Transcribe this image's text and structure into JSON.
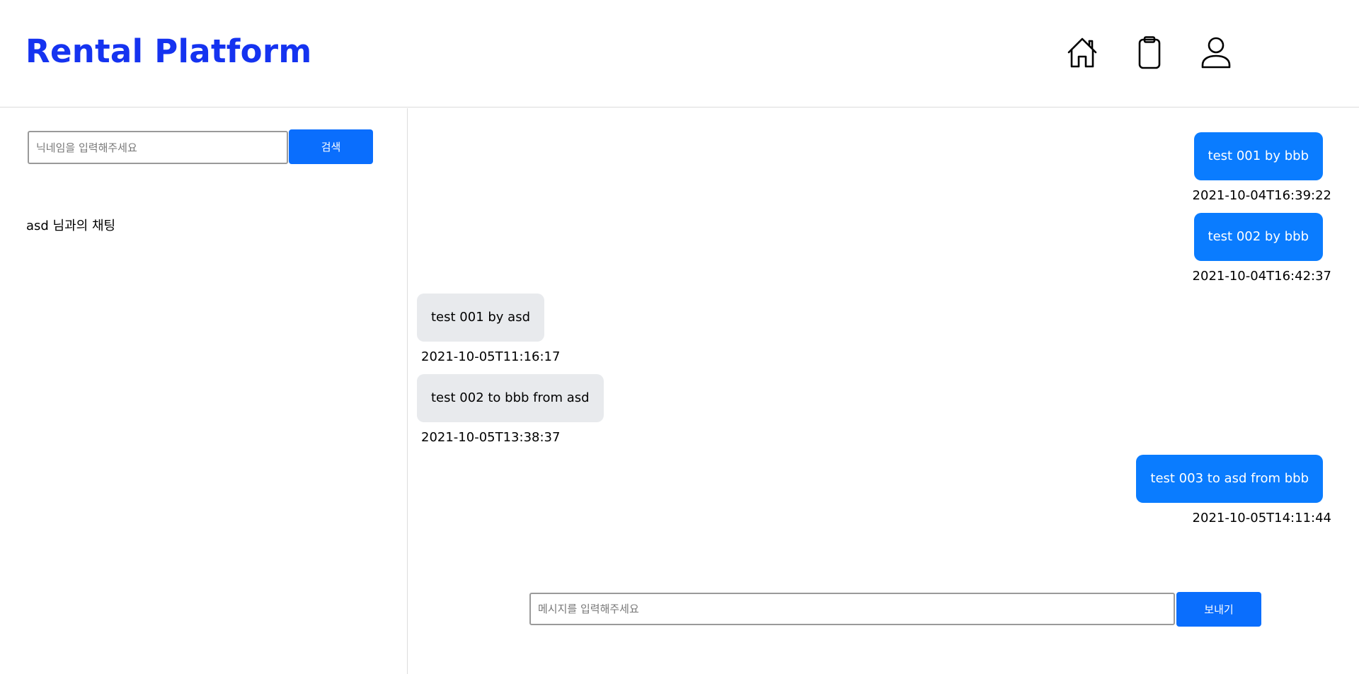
{
  "header": {
    "brand": "Rental Platform",
    "nav_icons": [
      "home-icon",
      "clipboard-icon",
      "user-icon"
    ]
  },
  "colors": {
    "brand": "#1533f0",
    "accent": "#0a6efd",
    "my_bubble": "#0a7cff",
    "their_bubble": "#e8eaed"
  },
  "sidebar": {
    "search_placeholder": "닉네임을 입력해주세요",
    "search_button": "검색",
    "rooms": [
      {
        "label": "asd 님과의 채팅"
      }
    ]
  },
  "chat": {
    "messages": [
      {
        "text": "test 001 by bbb",
        "time": "2021-10-04T16:39:22",
        "mine": true
      },
      {
        "text": "test 002 by bbb",
        "time": "2021-10-04T16:42:37",
        "mine": true
      },
      {
        "text": "test 001 by asd",
        "time": "2021-10-05T11:16:17",
        "mine": false
      },
      {
        "text": "test 002 to bbb from asd",
        "time": "2021-10-05T13:38:37",
        "mine": false
      },
      {
        "text": "test 003 to asd from bbb",
        "time": "2021-10-05T14:11:44",
        "mine": true
      }
    ],
    "composer_placeholder": "메시지를 입력해주세요",
    "send_button": "보내기"
  }
}
